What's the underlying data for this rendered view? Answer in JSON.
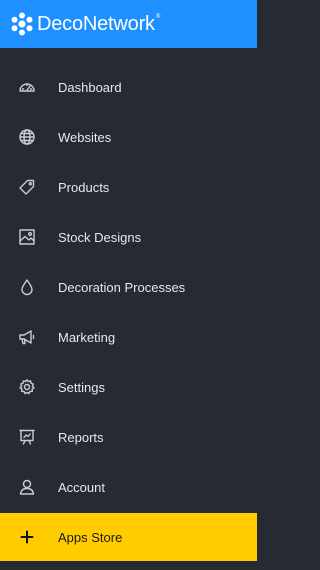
{
  "brand": {
    "name": "DecoNetwork",
    "reg_mark": "®",
    "header_color": "#1e90ff"
  },
  "sidebar": {
    "background": "#252a33",
    "items": [
      {
        "label": "Dashboard",
        "icon": "dashboard-gauge-icon"
      },
      {
        "label": "Websites",
        "icon": "globe-icon"
      },
      {
        "label": "Products",
        "icon": "tag-icon"
      },
      {
        "label": "Stock Designs",
        "icon": "image-icon"
      },
      {
        "label": "Decoration Processes",
        "icon": "drop-icon"
      },
      {
        "label": "Marketing",
        "icon": "megaphone-icon"
      },
      {
        "label": "Settings",
        "icon": "gear-icon"
      },
      {
        "label": "Reports",
        "icon": "report-icon"
      },
      {
        "label": "Account",
        "icon": "user-icon"
      },
      {
        "label": "Apps Store",
        "icon": "plus-icon",
        "highlight_color": "#ffcc00"
      }
    ]
  }
}
